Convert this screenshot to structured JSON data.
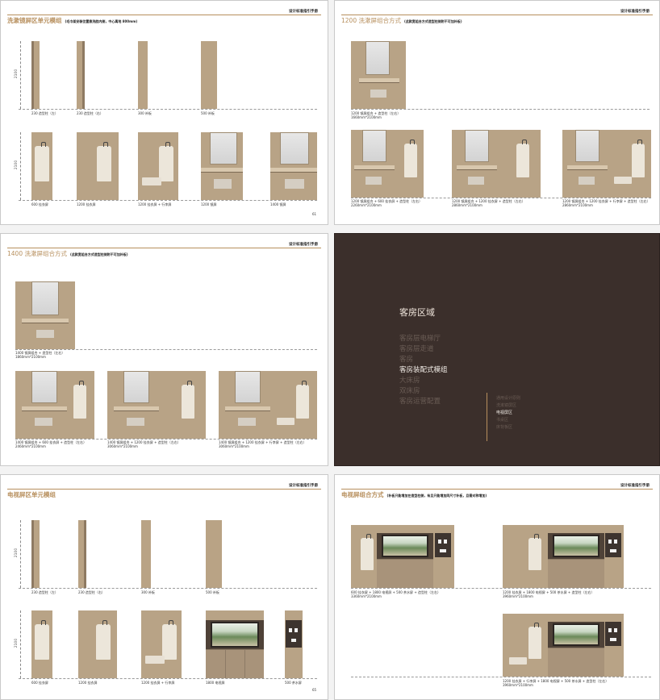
{
  "brand": "设计标准指引手册",
  "p1": {
    "title": "洗漱镜屏区单元模组",
    "note": "(毛巾架安装位置靠洗脸内侧，中心离地 800mm)",
    "dim": "2100",
    "units_top": [
      "230 造型柱（左）",
      "230 造型柱（右）",
      "300 补板",
      "500 补板"
    ],
    "units_bottom": [
      "600 挂衣屏",
      "1200 挂衣屏",
      "1200 挂衣屏 + 行李屏",
      "1200 镜屏",
      "1400 镜屏"
    ],
    "page_number": "61"
  },
  "p2": {
    "title": "1200 洗漱屏组合方式",
    "note": "(此款宽组合方式造型柱侧附不可加补板)",
    "combo_top": [
      "1200 镜屏组合 + 造型柱（左右）",
      "1660mm*2100mm"
    ],
    "combos": [
      [
        "1200 镜屏组合 + 600 挂衣屏 + 造型柱（左右）",
        "2260mm*2100mm"
      ],
      [
        "1200 镜屏组合 + 1200 挂衣屏 + 造型柱（左右）",
        "2860mm*2100mm"
      ],
      [
        "1200 镜屏组合 + 1200 挂衣屏 + 行李屏 + 造型柱（左右）",
        "2860mm*2100mm"
      ]
    ]
  },
  "p3": {
    "title": "1400 洗漱屏组合方式",
    "note": "(此款宽组合方式造型柱侧附不可加补板)",
    "combo_top": [
      "1400 镜屏组合 + 造型柱（左右）",
      "1860mm*2100mm"
    ],
    "combos": [
      [
        "1400 镜屏组合 + 600 挂衣屏 + 造型柱（左右）",
        "2460mm*2100mm"
      ],
      [
        "1400 镜屏组合 + 1200 挂衣屏 + 造型柱（左右）",
        "3060mm*2100mm"
      ],
      [
        "1400 镜屏组合 + 1200 挂衣屏 + 行李屏 + 造型柱（左右）",
        "3060mm*2100mm"
      ]
    ]
  },
  "p4": {
    "heading": "客房区域",
    "menu": [
      "客房层电梯厅",
      "客房层走道",
      "客房",
      "客房装配式模组",
      "大床房",
      "双床房",
      "客房运营配置"
    ],
    "active_menu": "客房装配式模组",
    "sub_menu": [
      "通用设计原则",
      "洗漱镜屏区",
      "电视屏区",
      "书桌区",
      "床背板区"
    ],
    "active_sub": "电视屏区"
  },
  "p5": {
    "title": "电视屏区单元模组",
    "dim": "2100",
    "units_top": [
      "230 造型柱（左）",
      "230 造型柱（右）",
      "300 补板",
      "500 补板"
    ],
    "units_bottom": [
      "600 挂衣屏",
      "1200 挂衣屏",
      "1200 挂衣屏 + 行李屏",
      "1800 电视屏",
      "500 茶水屏"
    ],
    "page_number": "65"
  },
  "p6": {
    "title": "电视屏组合方式",
    "note": "(补板只能增加在造型柱侧，有且只能增加同尺寸补板，且需对称增加)",
    "combos": [
      [
        "600 挂衣屏 + 1800 电视屏 + 500 茶水屏 + 造型柱（左右）",
        "3360mm*2100mm"
      ],
      [
        "1200 挂衣屏 + 1800 电视屏 + 500 茶水屏 + 造型柱（左右）",
        "3960mm*2100mm"
      ],
      [
        "1200 挂衣屏 + 行李屏 + 1800 电视屏 + 500 茶水屏 + 造型柱（左右）",
        "3960mm*2100mm"
      ]
    ]
  },
  "colors": {
    "accent": "#b78f5d",
    "wood": "#b9a385",
    "dark_page": "#3b2f2b"
  }
}
